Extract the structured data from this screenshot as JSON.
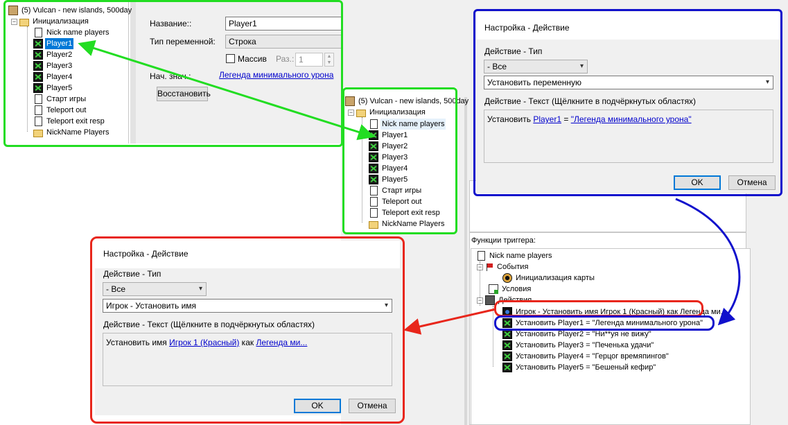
{
  "tree_top_left": {
    "root": "(5) Vulcan - new islands, 500day",
    "init": "Инициализация",
    "items": [
      "Nick name players",
      "Player1",
      "Player2",
      "Player3",
      "Player4",
      "Player5",
      "Старт игры",
      "Teleport out",
      "Teleport exit resp",
      "NickName Players"
    ]
  },
  "var_editor": {
    "name_label": "Название::",
    "name_value": "Player1",
    "type_label": "Тип переменной:",
    "type_value": "Строка",
    "array_label": "Массив",
    "size_label": "Раз.:",
    "size_value": "1",
    "init_label": "Нач. знач.:",
    "init_value": "Легенда минимального урона",
    "restore_button": "Восстановить"
  },
  "tree_middle": {
    "root": "(5) Vulcan - new islands, 500day",
    "init": "Инициализация",
    "items": [
      "Nick name players",
      "Player1",
      "Player2",
      "Player3",
      "Player4",
      "Player5",
      "Старт игры",
      "Teleport out",
      "Teleport exit resp",
      "NickName Players"
    ]
  },
  "dialog_blue": {
    "title": "Настройка -  Действие",
    "type_label": "Действие  - Тип",
    "filter_value": "- Все",
    "action_value": "Установить переменную",
    "text_label": "Действие  - Текст (Щёлкните в подчёркнутых областях)",
    "text_prefix": "Установить ",
    "text_var": "Player1",
    "text_eq": " = ",
    "text_value": "\"Легенда минимального урона\"",
    "ok": "OK",
    "cancel": "Отмена"
  },
  "dialog_red": {
    "title": "Настройка -  Действие",
    "type_label": "Действие  - Тип",
    "filter_value": "- Все",
    "action_value": "Игрок - Установить имя",
    "text_label": "Действие  - Текст (Щёлкните в подчёркнутых областях)",
    "text_prefix": "Установить имя ",
    "text_player": "Игрок 1 (Красный)",
    "text_as": " как ",
    "text_value": "Легенда ми...",
    "ok": "OK",
    "cancel": "Отмена"
  },
  "trigger_functions": {
    "header": "Функции триггера:",
    "trigger_name": "Nick name players",
    "events_label": "События",
    "event_item": "Инициализация карты",
    "conditions_label": "Условия",
    "actions_label": "Действия",
    "actions": [
      "Игрок - Установить имя Игрок 1 (Красный) как Легенда ми...",
      "Установить Player1 = \"Легенда минимального урона\"",
      "Установить Player2 = \"Ни**уя не вижу\"",
      "Установить Player3 = \"Печенька удачи\"",
      "Установить Player4 = \"Герцог времяпингов\"",
      "Установить Player5 = \"Бешеный кефир\""
    ]
  },
  "colors": {
    "green": "#22dd22",
    "blue": "#1010cc",
    "red": "#e8261b",
    "selection": "#0078d7"
  }
}
